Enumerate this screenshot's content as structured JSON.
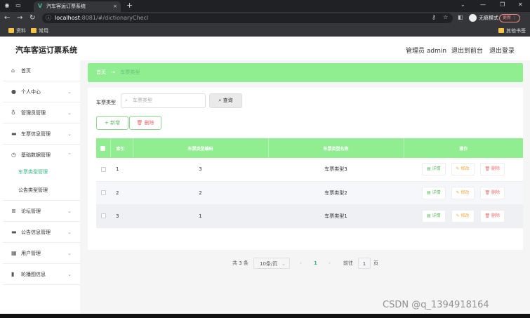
{
  "browser": {
    "tab_title": "汽车客运订票系统",
    "url_host": "localhost",
    "url_path": ":8081/#/dictionaryChecl",
    "incognito_label": "无痕模式",
    "update_label": "更新",
    "bookmarks": [
      "资料",
      "常用"
    ],
    "other_bookmarks": "其他书签"
  },
  "app": {
    "title": "汽车客运订票系统",
    "header_links": [
      "管理员 admin",
      "退出到前台",
      "退出登录"
    ]
  },
  "sidebar": {
    "items": [
      {
        "label": "首页",
        "icon": "home-icon"
      },
      {
        "label": "个人中心",
        "icon": "user-icon"
      },
      {
        "label": "管理员管理",
        "icon": "bulb-icon"
      },
      {
        "label": "车票信息管理",
        "icon": "monitor-icon"
      },
      {
        "label": "基础数据管理",
        "icon": "clock-icon"
      },
      {
        "label": "论坛管理",
        "icon": "list-icon"
      },
      {
        "label": "公告信息管理",
        "icon": "monitor-icon"
      },
      {
        "label": "用户管理",
        "icon": "grid-icon"
      },
      {
        "label": "轮播图信息",
        "icon": "bar-chart-icon"
      }
    ],
    "sub_items": [
      "车票类型管理",
      "公告类型管理"
    ]
  },
  "breadcrumb": {
    "home": "首页",
    "arrow": "→",
    "current": "车票类型"
  },
  "filter": {
    "label": "车票类型",
    "placeholder": "车票类型",
    "query_label": "查询"
  },
  "actions": {
    "add_label": "新增",
    "delete_label": "删除"
  },
  "table": {
    "headers": [
      "索引",
      "车票类型编码",
      "车票类型名称",
      "操作"
    ],
    "rows": [
      {
        "index": "1",
        "code": "3",
        "name": "车票类型3"
      },
      {
        "index": "2",
        "code": "2",
        "name": "车票类型2"
      },
      {
        "index": "3",
        "code": "1",
        "name": "车票类型1"
      }
    ],
    "row_actions": {
      "detail": "详情",
      "edit": "修改",
      "delete": "删除"
    }
  },
  "pagination": {
    "total": "共 3 条",
    "page_size": "10条/页",
    "current_page": "1",
    "goto_label": "前往",
    "goto_value": "1",
    "page_suffix": "页"
  },
  "watermark": "CSDN @q_1394918164",
  "colors": {
    "accent": "#90ee90",
    "active_text": "#34b884"
  }
}
